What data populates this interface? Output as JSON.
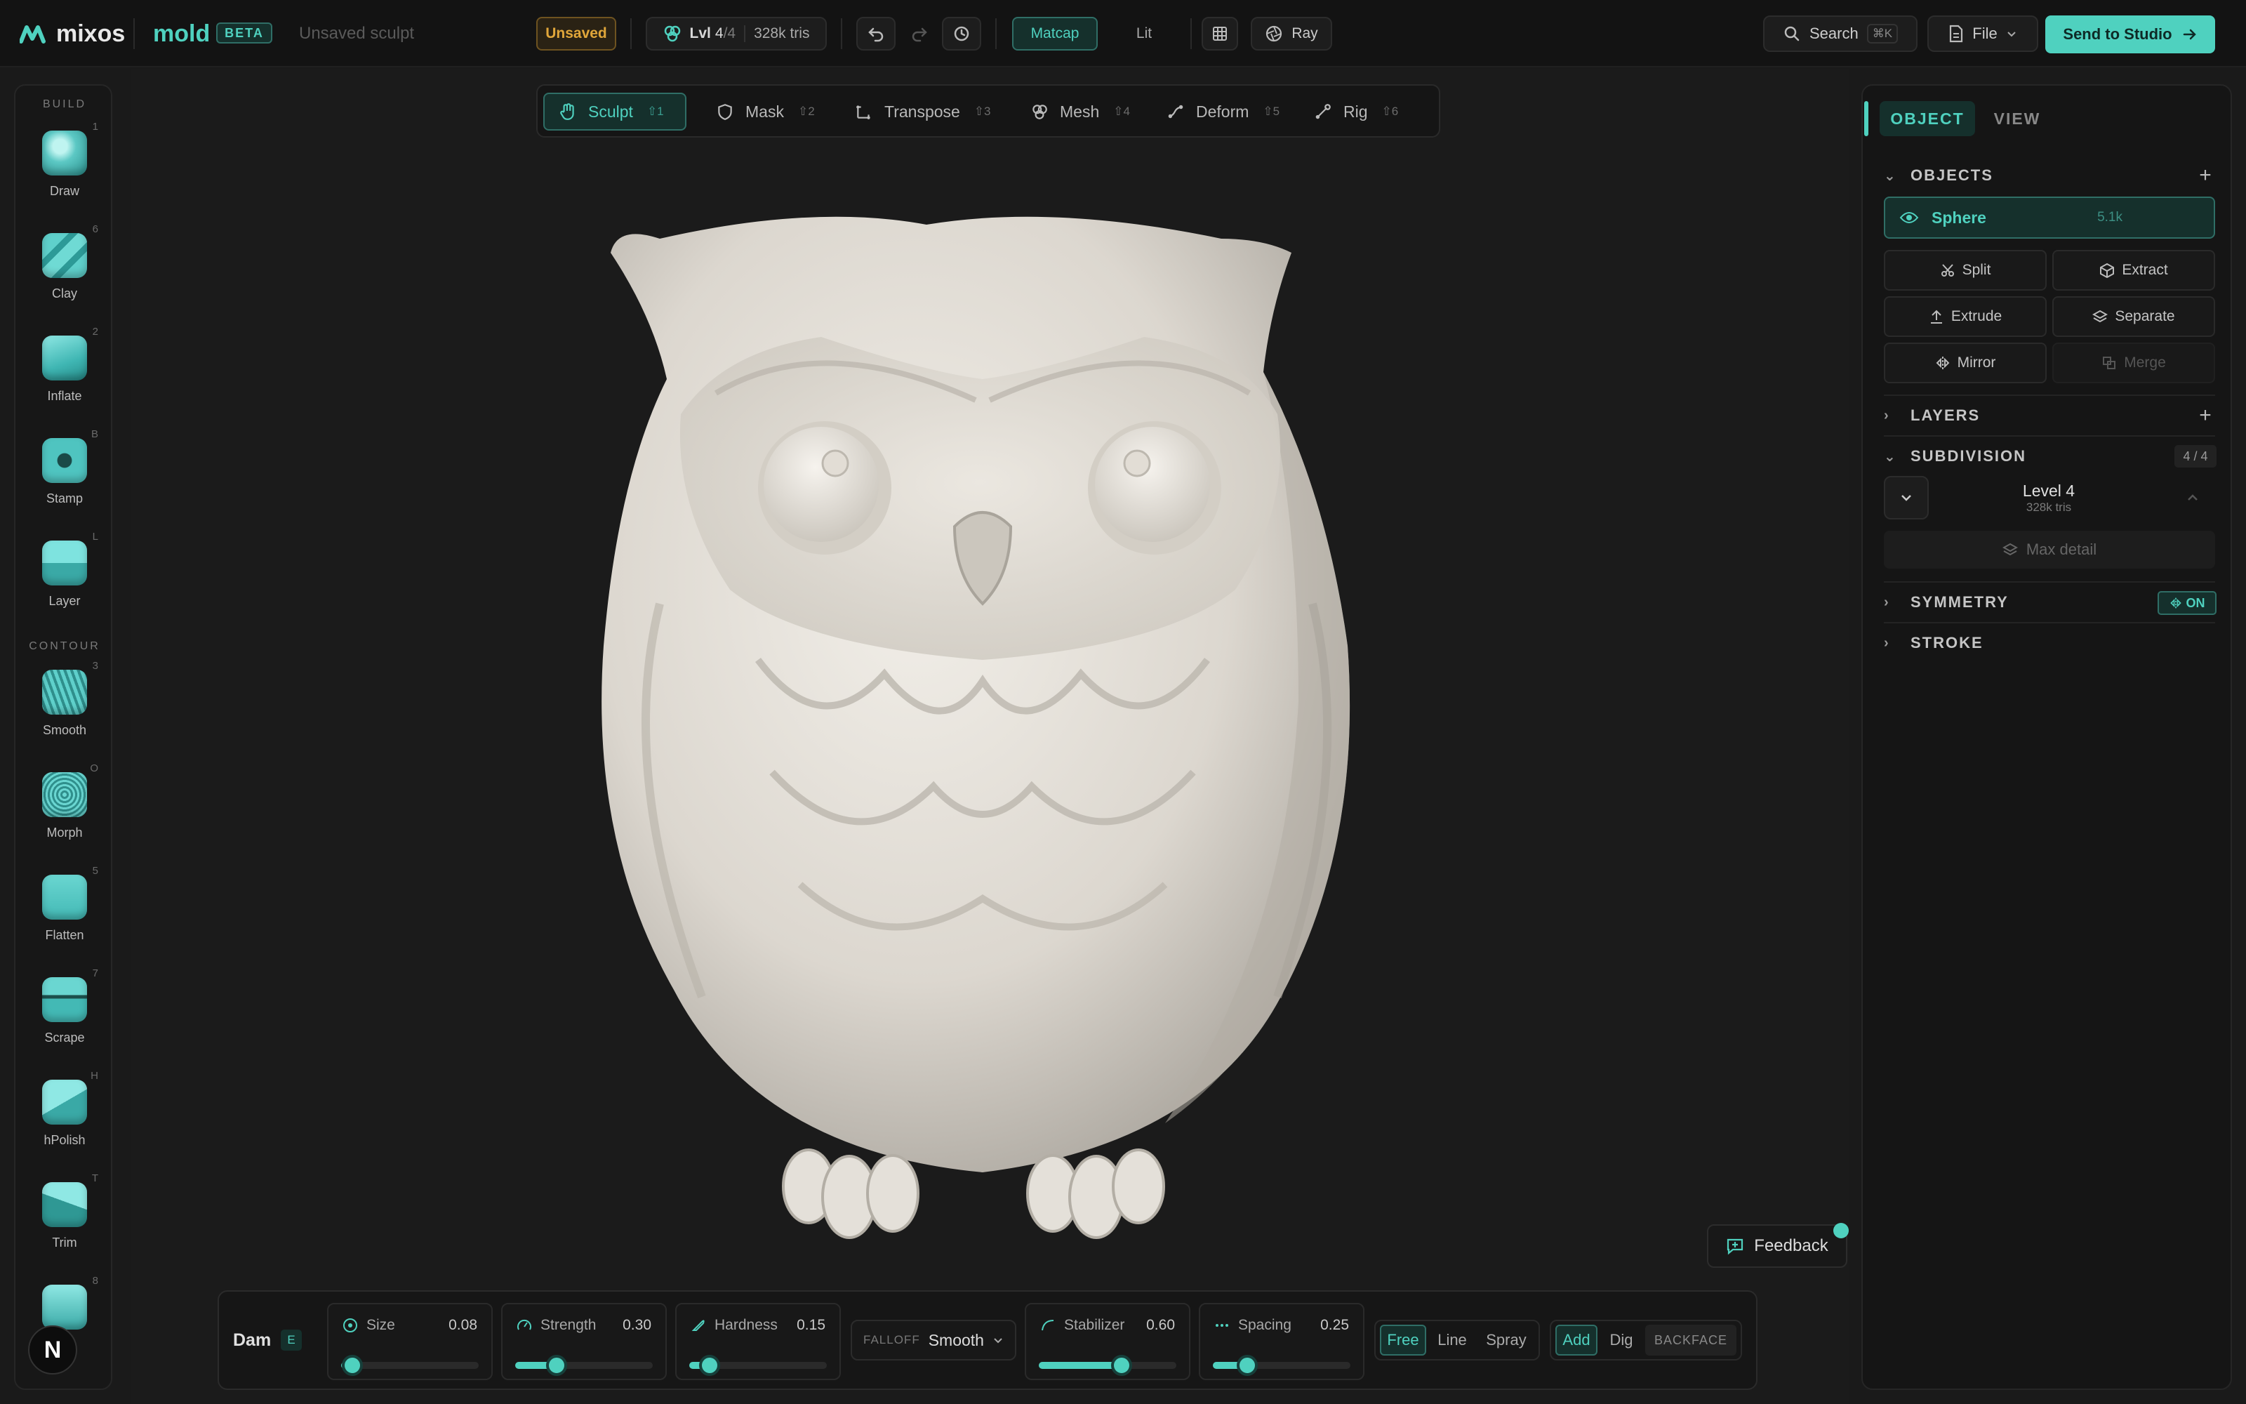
{
  "app": {
    "logo": "mixos",
    "product": "mold",
    "badge": "BETA",
    "doc_title": "Unsaved sculpt"
  },
  "topbar": {
    "status": "Unsaved",
    "level_prefix": "Lvl",
    "level_current": "4",
    "level_total": "/4",
    "tris": "328k tris",
    "shading": [
      "Matcap",
      "Lit"
    ],
    "shading_active": "Matcap",
    "render": "Ray",
    "search": "Search",
    "search_shortcut": "⌘K",
    "file": "File",
    "send": "Send to Studio"
  },
  "modes": [
    {
      "label": "Sculpt",
      "key": "1",
      "active": true
    },
    {
      "label": "Mask",
      "key": "2"
    },
    {
      "label": "Transpose",
      "key": "3"
    },
    {
      "label": "Mesh",
      "key": "4"
    },
    {
      "label": "Deform",
      "key": "5"
    },
    {
      "label": "Rig",
      "key": "6"
    }
  ],
  "sidebar": {
    "build_label": "BUILD",
    "contour_label": "CONTOUR",
    "tools": [
      {
        "label": "Draw",
        "key": "1"
      },
      {
        "label": "Clay",
        "key": "6"
      },
      {
        "label": "Inflate",
        "key": "2"
      },
      {
        "label": "Stamp",
        "key": "B"
      },
      {
        "label": "Layer",
        "key": "L"
      },
      {
        "label": "Smooth",
        "key": "3"
      },
      {
        "label": "Morph",
        "key": "O"
      },
      {
        "label": "Flatten",
        "key": "5"
      },
      {
        "label": "Scrape",
        "key": "7"
      },
      {
        "label": "hPolish",
        "key": "H"
      },
      {
        "label": "Trim",
        "key": "T"
      },
      {
        "label": "",
        "key": "8"
      }
    ]
  },
  "brushbar": {
    "brush": "Dam",
    "brush_key": "E",
    "size": {
      "label": "Size",
      "value": "0.08",
      "level": 0.08
    },
    "strength": {
      "label": "Strength",
      "value": "0.30",
      "level": 0.3
    },
    "hardness": {
      "label": "Hardness",
      "value": "0.15",
      "level": 0.15
    },
    "falloff_label": "FALLOFF",
    "falloff_value": "Smooth",
    "stabilizer": {
      "label": "Stabilizer",
      "value": "0.60",
      "level": 0.6
    },
    "spacing": {
      "label": "Spacing",
      "value": "0.25",
      "level": 0.25
    },
    "stroke_types": [
      "Free",
      "Line",
      "Spray"
    ],
    "stroke_active": "Free",
    "ops": [
      "Add",
      "Dig"
    ],
    "op_active": "Add",
    "backface": "BACKFACE"
  },
  "feedback": "Feedback",
  "rightpanel": {
    "tabs": [
      "OBJECT",
      "VIEW"
    ],
    "tab_active": "OBJECT",
    "objects_title": "OBJECTS",
    "object": {
      "name": "Sphere",
      "count": "5.1k"
    },
    "actions": [
      "Split",
      "Extract",
      "Extrude",
      "Separate",
      "Mirror",
      "Merge"
    ],
    "layers_title": "LAYERS",
    "subdivision_title": "SUBDIVISION",
    "subdivision_count": "4 / 4",
    "level_name": "Level 4",
    "level_tris": "328k tris",
    "max_detail": "Max detail",
    "symmetry_title": "SYMMETRY",
    "symmetry_state": "ON",
    "stroke_title": "STROKE"
  },
  "colors": {
    "accent": "#4fd1bf",
    "warning": "#e0a63a",
    "background": "#1b1b1b"
  }
}
